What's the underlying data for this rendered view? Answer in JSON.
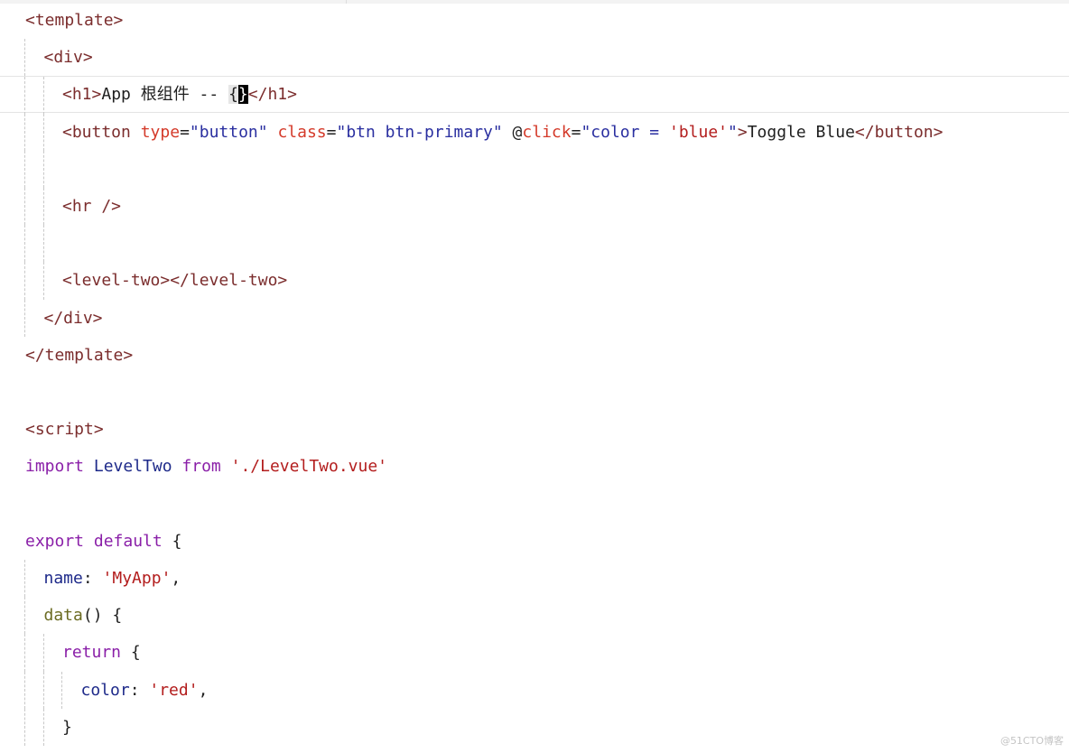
{
  "editor": {
    "lines": [
      {
        "indent": 0,
        "tokens": [
          [
            "tag",
            "<template>"
          ]
        ]
      },
      {
        "indent": 1,
        "tokens": [
          [
            "tag",
            "<div>"
          ]
        ]
      },
      {
        "indent": 2,
        "current": true,
        "tokens": [
          [
            "tag",
            "<h1>"
          ],
          [
            "text",
            "App "
          ],
          [
            "cjk",
            "根组件"
          ],
          [
            "text",
            " -- "
          ],
          [
            "brace-hl",
            "{"
          ],
          [
            "brace-cur",
            "}"
          ],
          [
            "tag",
            "</h1>"
          ]
        ]
      },
      {
        "indent": 2,
        "tokens": [
          [
            "tag",
            "<button "
          ],
          [
            "attr",
            "type"
          ],
          [
            "punct",
            "="
          ],
          [
            "str",
            "\"button\""
          ],
          [
            "punct",
            " "
          ],
          [
            "attr",
            "class"
          ],
          [
            "punct",
            "="
          ],
          [
            "str",
            "\"btn btn-primary\""
          ],
          [
            "punct",
            " @"
          ],
          [
            "attr",
            "click"
          ],
          [
            "punct",
            "="
          ],
          [
            "str",
            "\"color = "
          ],
          [
            "str2",
            "'blue'"
          ],
          [
            "str",
            "\""
          ],
          [
            "tag",
            ">"
          ],
          [
            "text",
            "Toggle Blue"
          ],
          [
            "tag",
            "</button>"
          ]
        ]
      },
      {
        "indent": 2,
        "tokens": []
      },
      {
        "indent": 2,
        "tokens": [
          [
            "tag",
            "<hr />"
          ]
        ]
      },
      {
        "indent": 2,
        "tokens": []
      },
      {
        "indent": 2,
        "tokens": [
          [
            "tag",
            "<level-two></level-two>"
          ]
        ]
      },
      {
        "indent": 1,
        "tokens": [
          [
            "tag",
            "</div>"
          ]
        ]
      },
      {
        "indent": 0,
        "tokens": [
          [
            "tag",
            "</template>"
          ]
        ]
      },
      {
        "indent": 0,
        "tokens": []
      },
      {
        "indent": 0,
        "tokens": [
          [
            "tag",
            "<script>"
          ]
        ]
      },
      {
        "indent": 0,
        "tokens": [
          [
            "kw",
            "import"
          ],
          [
            "punct",
            " "
          ],
          [
            "id",
            "LevelTwo"
          ],
          [
            "punct",
            " "
          ],
          [
            "kw",
            "from"
          ],
          [
            "punct",
            " "
          ],
          [
            "str2",
            "'./LevelTwo.vue'"
          ]
        ]
      },
      {
        "indent": 0,
        "tokens": []
      },
      {
        "indent": 0,
        "tokens": [
          [
            "kw",
            "export"
          ],
          [
            "punct",
            " "
          ],
          [
            "kw",
            "default"
          ],
          [
            "punct",
            " {"
          ]
        ]
      },
      {
        "indent": 1,
        "tokens": [
          [
            "id",
            "name"
          ],
          [
            "punct",
            ": "
          ],
          [
            "str2",
            "'MyApp'"
          ],
          [
            "punct",
            ","
          ]
        ]
      },
      {
        "indent": 1,
        "tokens": [
          [
            "fn",
            "data"
          ],
          [
            "punct",
            "() {"
          ]
        ]
      },
      {
        "indent": 2,
        "tokens": [
          [
            "kw",
            "return"
          ],
          [
            "punct",
            " {"
          ]
        ]
      },
      {
        "indent": 3,
        "tokens": [
          [
            "id",
            "color"
          ],
          [
            "punct",
            ": "
          ],
          [
            "str2",
            "'red'"
          ],
          [
            "punct",
            ","
          ]
        ]
      },
      {
        "indent": 2,
        "tokens": [
          [
            "punct",
            "}"
          ]
        ]
      }
    ]
  },
  "watermark": "@51CTO博客",
  "colors": {
    "tag": "#7b2d2d",
    "attr": "#d43a2a",
    "string": "#2a2fa0",
    "single_quote_string": "#b31d1d",
    "keyword": "#8a1fa8",
    "identifier": "#1e2a8a",
    "function": "#6b6b22"
  }
}
